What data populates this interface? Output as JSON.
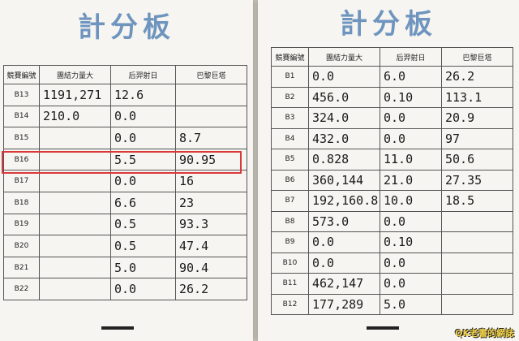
{
  "left_sheet": {
    "title": "計分板",
    "headers": [
      "競賽編號",
      "團結力量大",
      "后羿射日",
      "巴黎巨塔"
    ],
    "rows": [
      {
        "code": "B13",
        "c1": "1191,271",
        "c2": "12.6",
        "c3": ""
      },
      {
        "code": "B14",
        "c1": "210.0",
        "c2": "0.0",
        "c3": ""
      },
      {
        "code": "B15",
        "c1": "",
        "c2": "0.0",
        "c3": "8.7"
      },
      {
        "code": "B16",
        "c1": "",
        "c2": "5.5",
        "c3": "90.95"
      },
      {
        "code": "B17",
        "c1": "",
        "c2": "0.0",
        "c3": "16"
      },
      {
        "code": "B18",
        "c1": "",
        "c2": "6.6",
        "c3": "23"
      },
      {
        "code": "B19",
        "c1": "",
        "c2": "0.5",
        "c3": "93.3"
      },
      {
        "code": "B20",
        "c1": "",
        "c2": "0.5",
        "c3": "47.4"
      },
      {
        "code": "B21",
        "c1": "",
        "c2": "5.0",
        "c3": "90.4"
      },
      {
        "code": "B22",
        "c1": "",
        "c2": "0.0",
        "c3": "26.2"
      }
    ],
    "highlighted_row": "B16"
  },
  "right_sheet": {
    "title": "計分板",
    "headers": [
      "競賽編號",
      "團結力量大",
      "后羿射日",
      "巴黎巨塔"
    ],
    "rows": [
      {
        "code": "B1",
        "c1": "0.0",
        "c2": "6.0",
        "c3": "26.2"
      },
      {
        "code": "B2",
        "c1": "456.0",
        "c2": "0.10",
        "c3": "113.1"
      },
      {
        "code": "B3",
        "c1": "324.0",
        "c2": "0.0",
        "c3": "20.9"
      },
      {
        "code": "B4",
        "c1": "432.0",
        "c2": "0.0",
        "c3": "97"
      },
      {
        "code": "B5",
        "c1": "0.828",
        "c2": "11.0",
        "c3": "50.6"
      },
      {
        "code": "B6",
        "c1": "360,144",
        "c2": "21.0",
        "c3": "27.35"
      },
      {
        "code": "B7",
        "c1": "192,160.8",
        "c2": "10.0",
        "c3": "18.5"
      },
      {
        "code": "B8",
        "c1": "573.0",
        "c2": "0.0",
        "c3": ""
      },
      {
        "code": "B9",
        "c1": "0.0",
        "c2": "0.10",
        "c3": ""
      },
      {
        "code": "B10",
        "c1": "0.0",
        "c2": "0.0",
        "c3": ""
      },
      {
        "code": "B11",
        "c1": "462,147",
        "c2": "0.0",
        "c3": ""
      },
      {
        "code": "B12",
        "c1": "177,289",
        "c2": "5.0",
        "c3": ""
      }
    ]
  },
  "watermark": "QK老書的網誌",
  "colors": {
    "title": "#6f95bf",
    "highlight": "#d9393a"
  }
}
